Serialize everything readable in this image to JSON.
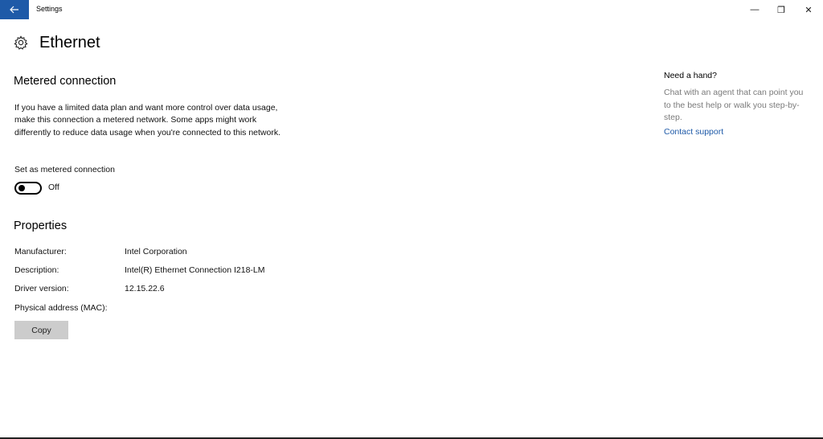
{
  "window": {
    "app_title": "Settings",
    "back_icon": "arrow-left-icon",
    "minimize_glyph": "—",
    "maximize_glyph": "❐",
    "close_glyph": "✕",
    "accent_color": "#1e5aa8"
  },
  "page": {
    "icon": "gear-icon",
    "title": "Ethernet"
  },
  "metered": {
    "heading": "Metered connection",
    "description": "If you have a limited data plan and want more control over data usage, make this connection a metered network. Some apps might work differently to reduce data usage when you're connected to this network.",
    "toggle_label": "Set as metered connection",
    "toggle_on": false,
    "toggle_state": "Off"
  },
  "properties": {
    "heading": "Properties",
    "rows": [
      {
        "label": "Manufacturer:",
        "value": "Intel Corporation"
      },
      {
        "label": "Description:",
        "value": "Intel(R) Ethernet Connection I218-LM"
      },
      {
        "label": "Driver version:",
        "value": "12.15.22.6"
      },
      {
        "label": "Physical address (MAC):",
        "value": ""
      }
    ],
    "copy_label": "Copy"
  },
  "help": {
    "title": "Need a hand?",
    "text": "Chat with an agent that can point you to the best help or walk you step-by-step.",
    "link": "Contact support"
  }
}
